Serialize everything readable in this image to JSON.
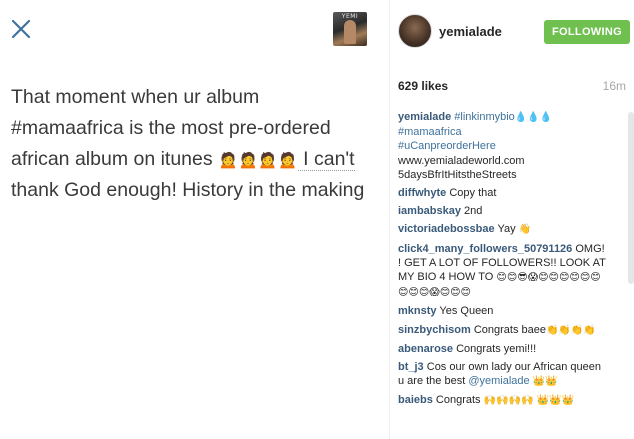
{
  "close": {
    "icon": "close-icon"
  },
  "post": {
    "line1": "That moment when ur album",
    "line2": "#mamaafrica  is the most pre-ordered",
    "line3a": "african  album on itunes ",
    "emojis": "🙍🙍🙍🙍",
    "line3b": " I can't",
    "line4": "thank God enough! History in the making"
  },
  "header": {
    "username": "yemialade",
    "follow_label": "FOLLOWING"
  },
  "stats": {
    "likes": "629 likes",
    "time": "16m"
  },
  "caption": {
    "user": "yemialade",
    "tag1": "#linkinmybio",
    "drops": "💧💧💧",
    "tag2": "#mamaafrica",
    "tag3": "#uCanpreorderHere",
    "url": "www.yemialadeworld.com",
    "tail": "5daysBfrItHitstheStreets"
  },
  "comments": [
    {
      "user": "diffwhyte",
      "text": "Copy that",
      "sym": ""
    },
    {
      "user": "iambabskay",
      "text": "2nd",
      "sym": ""
    },
    {
      "user": "victoriadebossbae",
      "text": "Yay",
      "sym": "👋"
    },
    {
      "user": "click4_many_followers_50791126",
      "text": "OMG! ! GET A LOT OF FOLLOWERS!! LOOK AT MY BIO 4 HOW TO",
      "sym": "😊😊😎😱😊😊😊😊😊😊😊😊😊😱😊😊😊"
    },
    {
      "user": "mknsty",
      "text": "Yes Queen",
      "sym": ""
    },
    {
      "user": "sinzbychisom",
      "text": "Congrats baee",
      "sym": "👏👏👏👏"
    },
    {
      "user": "abenarose",
      "text": "Congrats yemi!!!",
      "sym": ""
    },
    {
      "user": "bt_j3",
      "text": "Cos our own lady our African queen u are the best",
      "tag": "@yemialade",
      "sym": "👑👑"
    },
    {
      "user": "baiebs",
      "text": "Congrats",
      "sym": "🙌🙌🙌🙌 👑👑👑"
    }
  ]
}
